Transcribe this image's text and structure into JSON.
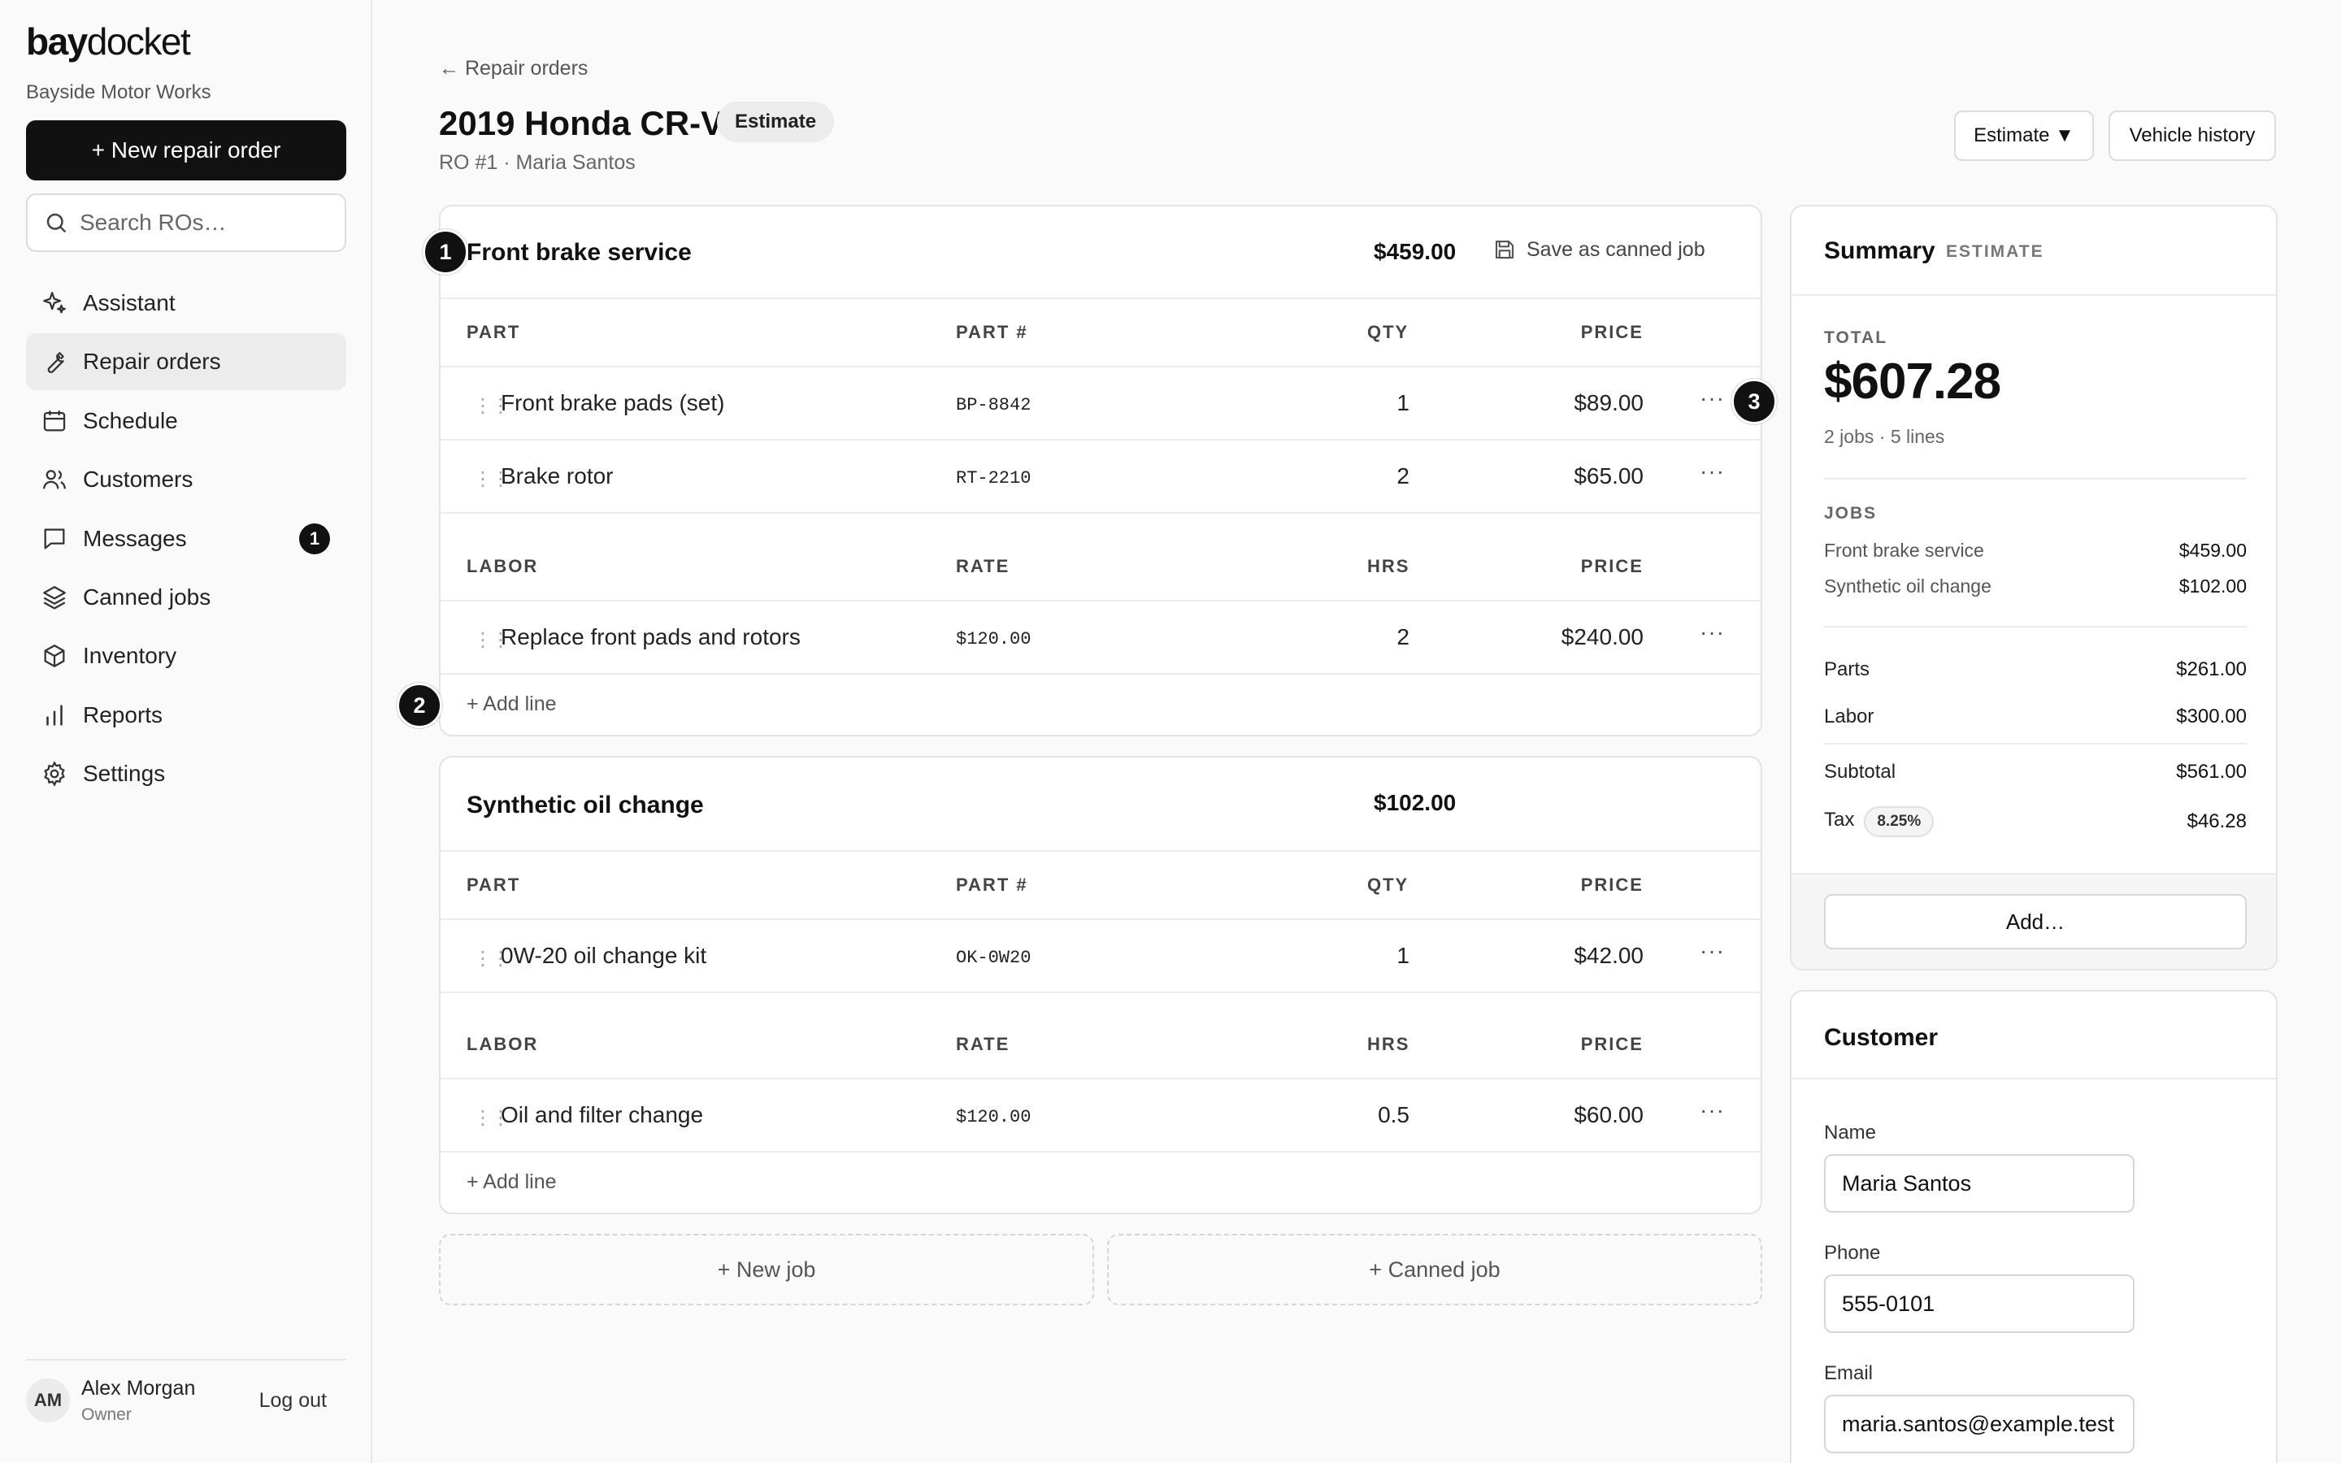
{
  "brand": {
    "logo_bold": "bay",
    "logo_rest": "docket",
    "shop_name": "Bayside Motor Works"
  },
  "sidebar": {
    "new_ro_label": "+  New repair order",
    "search_placeholder": "Search ROs…",
    "items": [
      {
        "label": "Assistant",
        "icon": "sparkle-icon"
      },
      {
        "label": "Repair orders",
        "icon": "wrench-icon",
        "active": true
      },
      {
        "label": "Schedule",
        "icon": "calendar-icon"
      },
      {
        "label": "Customers",
        "icon": "users-icon"
      },
      {
        "label": "Messages",
        "icon": "message-icon",
        "badge": "1"
      },
      {
        "label": "Canned jobs",
        "icon": "layers-icon"
      },
      {
        "label": "Inventory",
        "icon": "box-icon"
      },
      {
        "label": "Reports",
        "icon": "bar-chart-icon"
      },
      {
        "label": "Settings",
        "icon": "gear-icon"
      }
    ],
    "user": {
      "initials": "AM",
      "name": "Alex Morgan",
      "role": "Owner",
      "logout_label": "Log out"
    }
  },
  "header": {
    "back_label": "← Repair orders",
    "title": "2019 Honda CR-V",
    "status": "Estimate",
    "subtitle": "RO #1 · Maria Santos",
    "status_dropdown": "Estimate ▼",
    "vehicle_history": "Vehicle history"
  },
  "jobs": [
    {
      "title": "Front brake service",
      "total": "$459.00",
      "save_canned_label": "Save as canned job",
      "parts_headers": {
        "part": "PART",
        "part_no": "PART #",
        "qty": "QTY",
        "price": "PRICE"
      },
      "parts": [
        {
          "name": "Front brake pads (set)",
          "part_no": "BP-8842",
          "qty": "1",
          "price": "$89.00"
        },
        {
          "name": "Brake rotor",
          "part_no": "RT-2210",
          "qty": "2",
          "price": "$65.00"
        }
      ],
      "labor_headers": {
        "labor": "LABOR",
        "rate": "RATE",
        "hrs": "HRS",
        "price": "PRICE"
      },
      "labor": [
        {
          "name": "Replace front pads and rotors",
          "rate": "$120.00",
          "hrs": "2",
          "price": "$240.00"
        }
      ],
      "add_line_label": "+ Add line"
    },
    {
      "title": "Synthetic oil change",
      "total": "$102.00",
      "parts_headers": {
        "part": "PART",
        "part_no": "PART #",
        "qty": "QTY",
        "price": "PRICE"
      },
      "parts": [
        {
          "name": "0W-20 oil change kit",
          "part_no": "OK-0W20",
          "qty": "1",
          "price": "$42.00"
        }
      ],
      "labor_headers": {
        "labor": "LABOR",
        "rate": "RATE",
        "hrs": "HRS",
        "price": "PRICE"
      },
      "labor": [
        {
          "name": "Oil and filter change",
          "rate": "$120.00",
          "hrs": "0.5",
          "price": "$60.00"
        }
      ],
      "add_line_label": "+ Add line"
    }
  ],
  "job_actions": {
    "new_job": "+ New job",
    "canned_job": "+ Canned job"
  },
  "summary": {
    "title": "Summary",
    "status": "ESTIMATE",
    "total_label": "TOTAL",
    "total": "$607.28",
    "meta": "2 jobs · 5 lines",
    "jobs_label": "JOBS",
    "jobs": [
      {
        "name": "Front brake service",
        "amount": "$459.00"
      },
      {
        "name": "Synthetic oil change",
        "amount": "$102.00"
      }
    ],
    "parts_label": "Parts",
    "parts": "$261.00",
    "labor_label": "Labor",
    "labor": "$300.00",
    "subtotal_label": "Subtotal",
    "subtotal": "$561.00",
    "tax_label": "Tax",
    "tax_rate": "8.25%",
    "tax": "$46.28",
    "add_label": "Add…"
  },
  "customer": {
    "title": "Customer",
    "name_label": "Name",
    "name": "Maria Santos",
    "phone_label": "Phone",
    "phone": "555-0101",
    "email_label": "Email",
    "email": "maria.santos@example.test"
  },
  "markers": [
    "1",
    "2",
    "3"
  ]
}
